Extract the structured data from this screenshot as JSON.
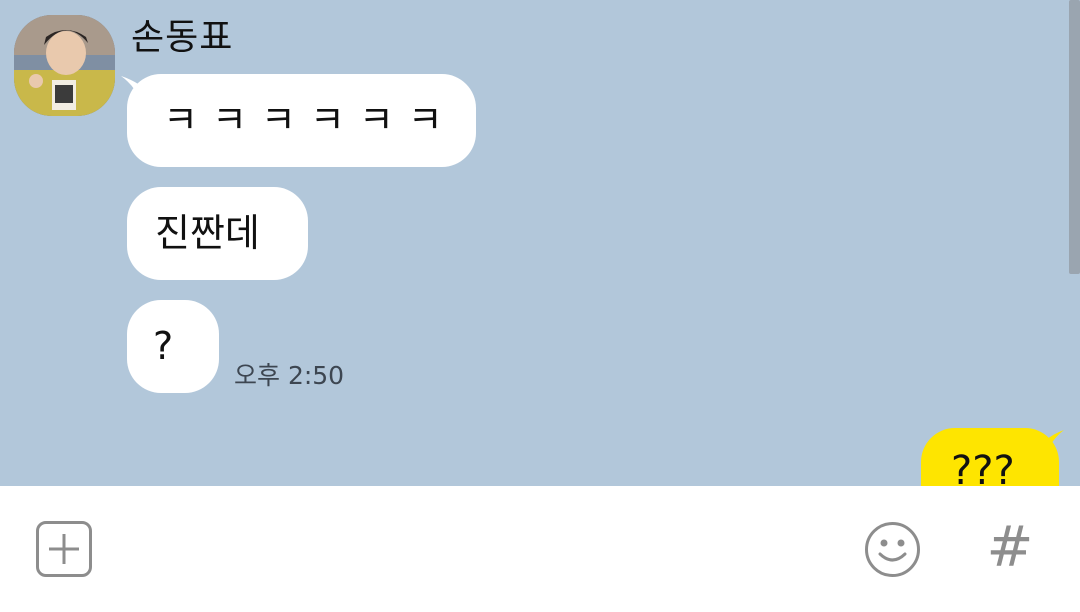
{
  "chat": {
    "sender": {
      "name": "손동표"
    },
    "messages": [
      {
        "from": "other",
        "text": "ㅋㅋㅋㅋㅋㅋ"
      },
      {
        "from": "other",
        "text": "진짠데"
      },
      {
        "from": "other",
        "text": "?"
      }
    ],
    "timestamp": "오후 2:50",
    "my_messages": [
      {
        "from": "me",
        "text": "???"
      }
    ]
  },
  "input_bar": {
    "attach_icon": "plus-square-icon",
    "emoji_icon": "smiley-icon",
    "hash_label": "#"
  },
  "colors": {
    "chat_background": "#b2c7da",
    "my_bubble": "#fee500",
    "other_bubble": "#ffffff",
    "icon_gray": "#8d8d8d"
  }
}
